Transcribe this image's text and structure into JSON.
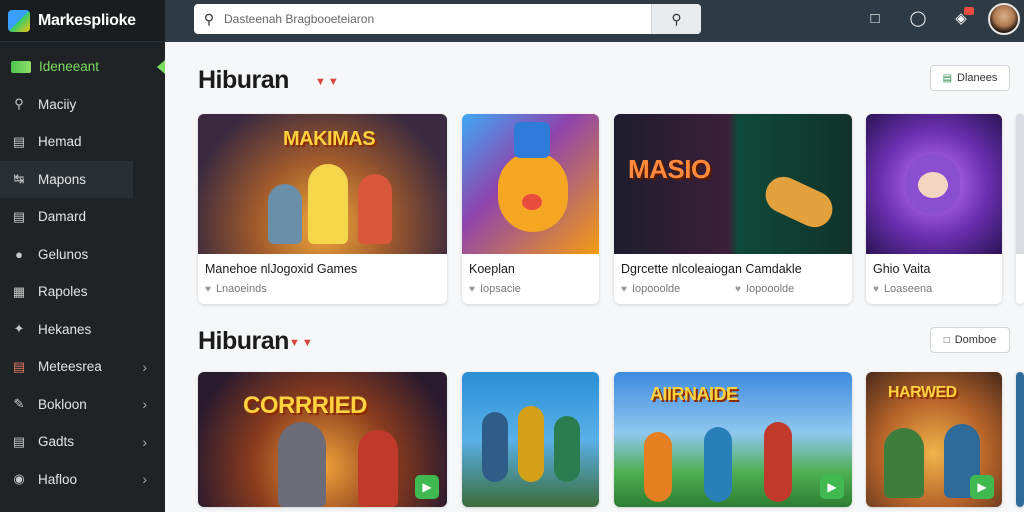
{
  "app": {
    "brand": "Markesplioke"
  },
  "search": {
    "placeholder": "Dasteenah Bragbooeteiaron"
  },
  "sidebar": {
    "items": [
      {
        "label": "Ideneeant",
        "icon": "gamepad-icon"
      },
      {
        "label": "Maciiy",
        "icon": "search-icon"
      },
      {
        "label": "Hemad",
        "icon": "list-icon"
      },
      {
        "label": "Mapons",
        "icon": "route-icon"
      },
      {
        "label": "Damard",
        "icon": "document-icon"
      },
      {
        "label": "Gelunos",
        "icon": "tag-icon"
      },
      {
        "label": "Rapoles",
        "icon": "clipboard-icon"
      },
      {
        "label": "Hekanes",
        "icon": "puzzle-icon"
      },
      {
        "label": "Meteesrea",
        "icon": "flag-icon"
      },
      {
        "label": "Bokloon",
        "icon": "pencil-icon"
      },
      {
        "label": "Gadts",
        "icon": "calendar-icon"
      },
      {
        "label": "Hafloo",
        "icon": "globe-icon"
      }
    ]
  },
  "sections": [
    {
      "title": "Hiburan",
      "button": "Dlanees",
      "cards": [
        {
          "title": "Manehoe nlJogoxid Games",
          "meta": "Lnaoeinds",
          "thumb_text": "MAKIMAS"
        },
        {
          "title": "Koeplan",
          "meta": "Iopsacie",
          "thumb_text": ""
        },
        {
          "title": "Dgrcette nlcoleaiogan Camdakle",
          "meta": "Iopooolde",
          "meta2": "Iopooolde",
          "thumb_text": "MASIO"
        },
        {
          "title": "Ghio Vaita",
          "meta": "Loaseena",
          "thumb_text": ""
        }
      ]
    },
    {
      "title": "Hiburan",
      "button": "Domboe",
      "cards": [
        {
          "thumb_text": "CORRRIED"
        },
        {
          "thumb_text": ""
        },
        {
          "thumb_text": "AIIRNAIDE"
        },
        {
          "thumb_text": "HARWED"
        }
      ]
    }
  ]
}
